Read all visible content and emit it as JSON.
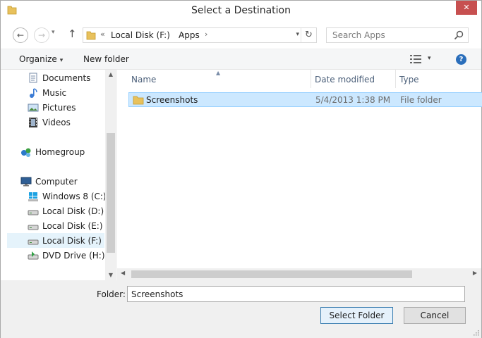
{
  "window": {
    "title": "Select a Destination",
    "close_glyph": "✕"
  },
  "navigation": {
    "back_glyph": "←",
    "forward_glyph": "→",
    "recent_glyph": "▾",
    "up_glyph": "↑",
    "address": {
      "overflow_glyph": "«",
      "segments": [
        "Local Disk (F:)",
        "Apps"
      ],
      "separator_glyph": "›",
      "dropdown_glyph": "▾",
      "refresh_glyph": "↻"
    },
    "search": {
      "placeholder": "Search Apps"
    }
  },
  "toolbar": {
    "organize_label": "Organize",
    "caret": "▾",
    "new_folder_label": "New folder",
    "help_glyph": "?"
  },
  "sidebar": {
    "items": [
      {
        "label": "Documents",
        "icon": "documents-icon"
      },
      {
        "label": "Music",
        "icon": "music-icon"
      },
      {
        "label": "Pictures",
        "icon": "pictures-icon"
      },
      {
        "label": "Videos",
        "icon": "videos-icon"
      },
      {
        "label": "Homegroup",
        "icon": "homegroup-icon"
      },
      {
        "label": "Computer",
        "icon": "computer-icon"
      },
      {
        "label": "Windows 8 (C:)",
        "icon": "windows-drive-icon"
      },
      {
        "label": "Local Disk (D:)",
        "icon": "drive-icon"
      },
      {
        "label": "Local Disk (E:)",
        "icon": "drive-icon"
      },
      {
        "label": "Local Disk (F:)",
        "icon": "drive-icon",
        "selected": true
      },
      {
        "label": "DVD Drive (H:) W",
        "icon": "dvd-drive-icon"
      }
    ],
    "scroll_up": "▲",
    "scroll_down": "▼"
  },
  "files": {
    "columns": [
      "Name",
      "Date modified",
      "Type"
    ],
    "sort_glyph": "▲",
    "rows": [
      {
        "name": "Screenshots",
        "date": "5/4/2013 1:38 PM",
        "type": "File folder",
        "selected": true
      }
    ],
    "scroll_left": "◀",
    "scroll_right": "▶"
  },
  "footer": {
    "folder_label": "Folder:",
    "folder_value": "Screenshots",
    "select_button": "Select Folder",
    "cancel_button": "Cancel"
  },
  "colors": {
    "selection": "#cce8ff",
    "selection_border": "#99d1ff",
    "close_button": "#c75050",
    "help_icon": "#2a6ebb",
    "folder_yellow": "#e8c15c"
  }
}
